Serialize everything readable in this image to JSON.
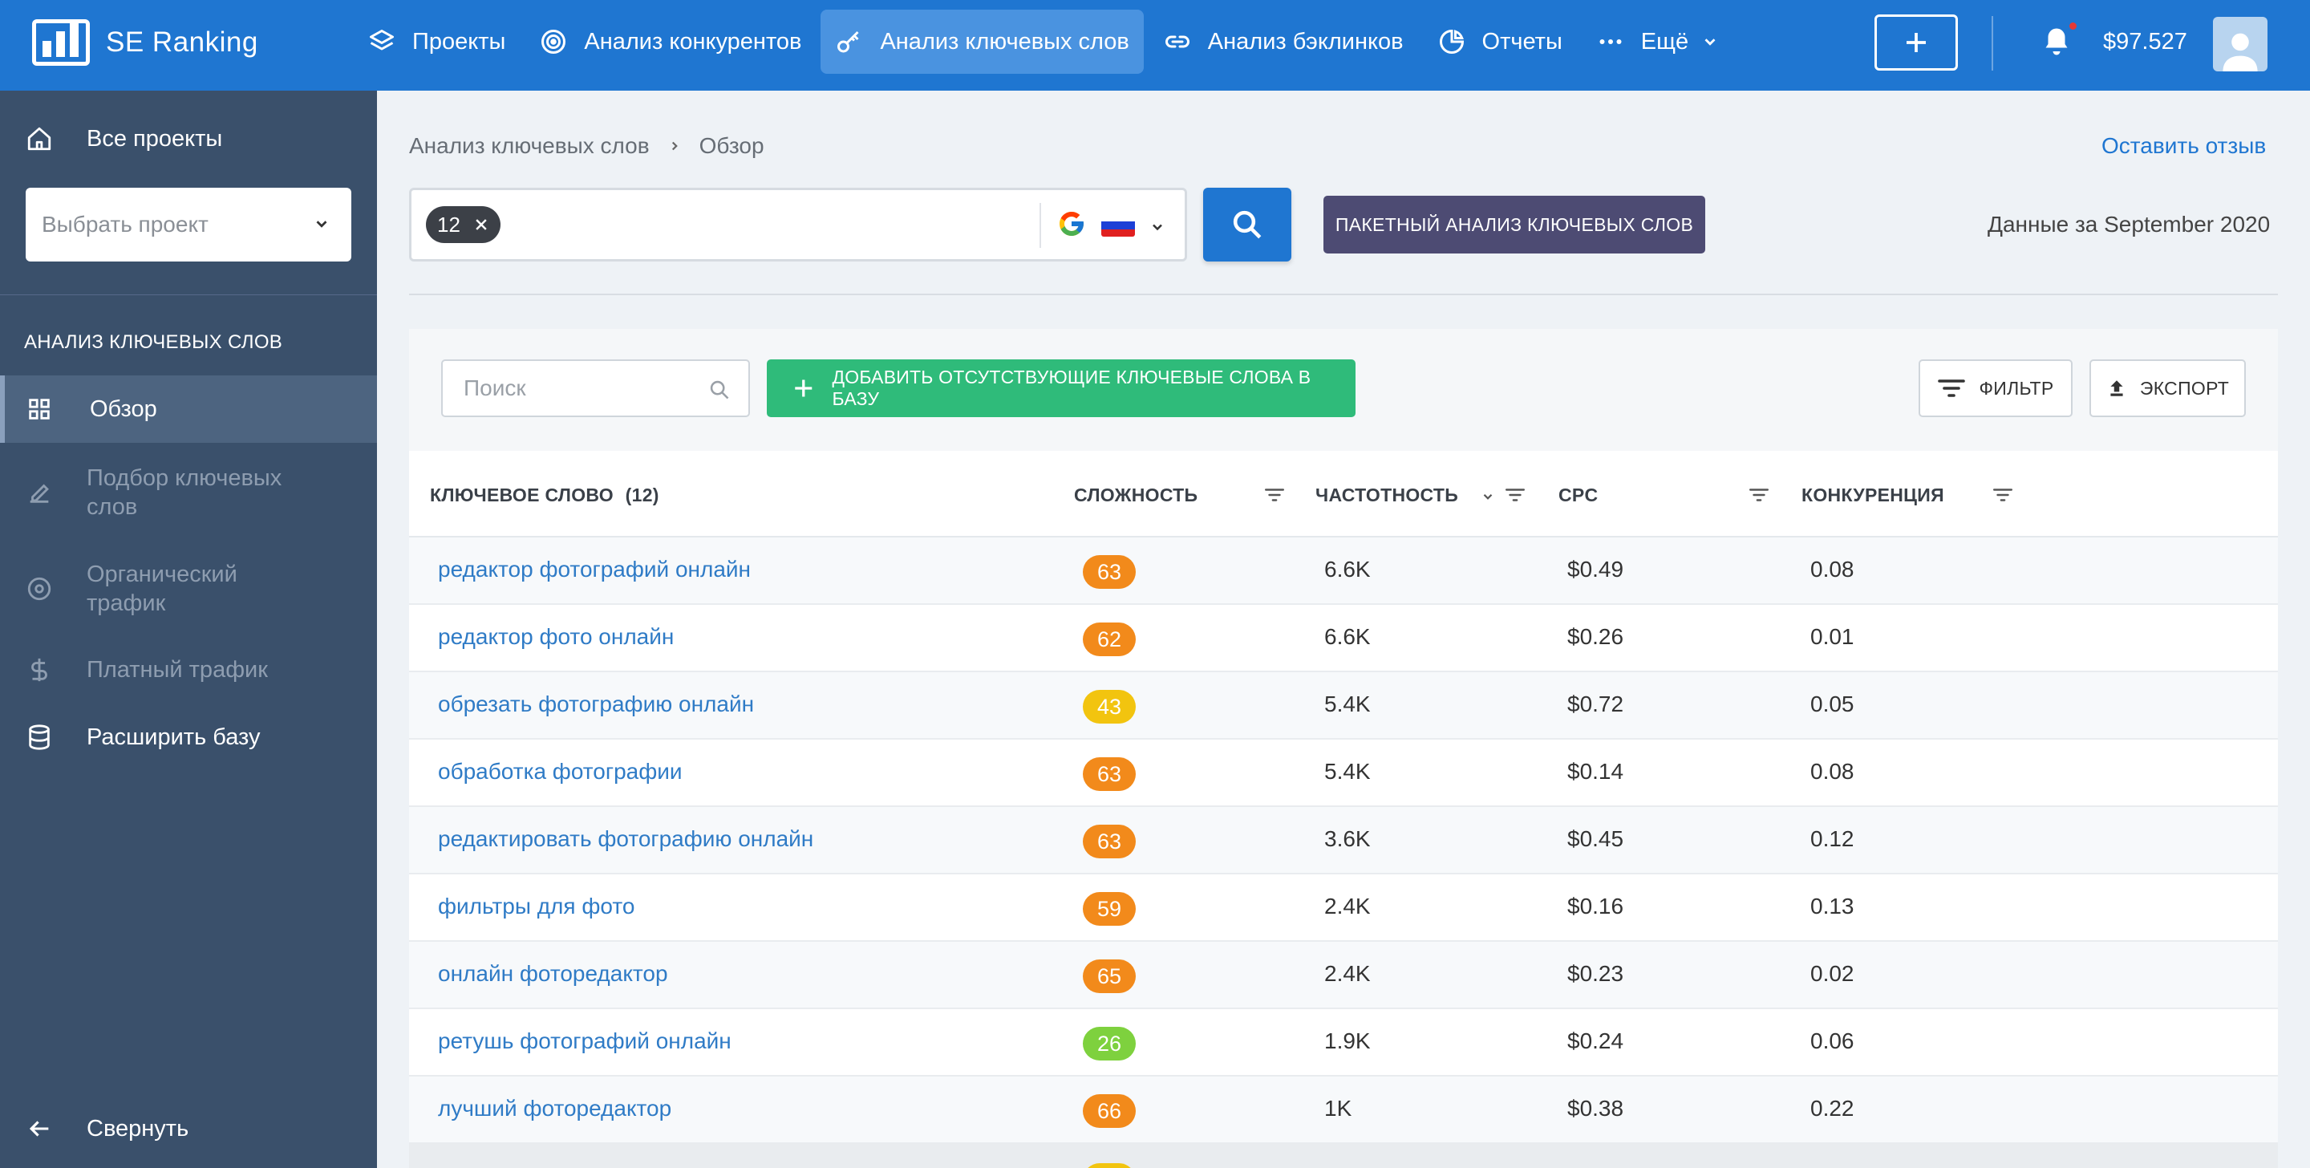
{
  "app": {
    "logo_text": "SE Ranking"
  },
  "topnav": {
    "items": [
      {
        "label": "Проекты",
        "icon": "layers-icon"
      },
      {
        "label": "Анализ конкурентов",
        "icon": "target-icon"
      },
      {
        "label": "Анализ ключевых слов",
        "icon": "key-icon",
        "active": true
      },
      {
        "label": "Анализ бэклинков",
        "icon": "link-icon"
      },
      {
        "label": "Отчеты",
        "icon": "pie-chart-icon"
      },
      {
        "label": "Ещё",
        "icon": "more-dots-icon"
      }
    ],
    "balance": "$97.527"
  },
  "sidebar": {
    "all_projects": "Все проекты",
    "project_placeholder": "Выбрать проект",
    "section_title": "АНАЛИЗ КЛЮЧЕВЫХ СЛОВ",
    "items": [
      {
        "label": "Обзор",
        "active": true
      },
      {
        "label_line1": "Подбор ключевых",
        "label_line2": "слов"
      },
      {
        "label_line1": "Органический",
        "label_line2": "трафик"
      },
      {
        "label": "Платный трафик"
      },
      {
        "label": "Расширить базу"
      }
    ],
    "collapse": "Свернуть"
  },
  "breadcrumb": {
    "parent": "Анализ ключевых слов",
    "current": "Обзор"
  },
  "feedback_link": "Оставить отзыв",
  "search": {
    "chip_value": "12"
  },
  "batch_button": "ПАКЕТНЫЙ АНАЛИЗ КЛЮЧЕВЫХ СЛОВ",
  "data_date": "Данные за September 2020",
  "toolbar": {
    "filter_placeholder": "Поиск",
    "add_button": "ДОБАВИТЬ ОТСУТСТВУЮЩИЕ КЛЮЧЕВЫЕ СЛОВА В БАЗУ",
    "filter_button": "ФИЛЬТР",
    "export_button": "ЭКСПОРТ"
  },
  "table": {
    "headers": {
      "keyword": "КЛЮЧЕВОЕ СЛОВО",
      "keyword_count": "(12)",
      "difficulty": "СЛОЖНОСТЬ",
      "volume": "ЧАСТОТНОСТЬ",
      "cpc": "CPC",
      "competition": "КОНКУРЕНЦИЯ"
    },
    "rows": [
      {
        "keyword": "редактор фотографий онлайн",
        "difficulty": "63",
        "diff_color": "#f28a1b",
        "volume": "6.6K",
        "cpc": "$0.49",
        "competition": "0.08"
      },
      {
        "keyword": "редактор фото онлайн",
        "difficulty": "62",
        "diff_color": "#f28a1b",
        "volume": "6.6K",
        "cpc": "$0.26",
        "competition": "0.01"
      },
      {
        "keyword": "обрезать фотографию онлайн",
        "difficulty": "43",
        "diff_color": "#f2c40f",
        "volume": "5.4K",
        "cpc": "$0.72",
        "competition": "0.05"
      },
      {
        "keyword": "обработка фотографии",
        "difficulty": "63",
        "diff_color": "#f28a1b",
        "volume": "5.4K",
        "cpc": "$0.14",
        "competition": "0.08"
      },
      {
        "keyword": "редактировать фотографию онлайн",
        "difficulty": "63",
        "diff_color": "#f28a1b",
        "volume": "3.6K",
        "cpc": "$0.45",
        "competition": "0.12"
      },
      {
        "keyword": "фильтры для фото",
        "difficulty": "59",
        "diff_color": "#f28a1b",
        "volume": "2.4K",
        "cpc": "$0.16",
        "competition": "0.13"
      },
      {
        "keyword": "онлайн фоторедактор",
        "difficulty": "65",
        "diff_color": "#f28a1b",
        "volume": "2.4K",
        "cpc": "$0.23",
        "competition": "0.02"
      },
      {
        "keyword": "ретушь фотографий онлайн",
        "difficulty": "26",
        "diff_color": "#7ed13e",
        "volume": "1.9K",
        "cpc": "$0.24",
        "competition": "0.06"
      },
      {
        "keyword": "лучший фоторедактор",
        "difficulty": "66",
        "diff_color": "#f28a1b",
        "volume": "1K",
        "cpc": "$0.38",
        "competition": "0.22"
      }
    ]
  },
  "colors": {
    "primary": "#1f76d1",
    "sidebar": "#3a506b",
    "green": "#2fbb7a",
    "purple": "#4d4b73"
  }
}
